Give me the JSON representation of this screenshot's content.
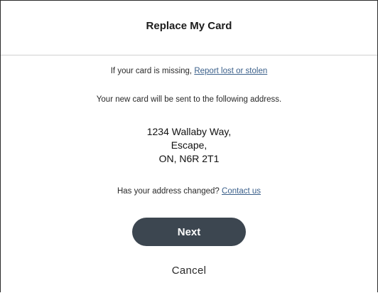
{
  "dialog": {
    "title": "Replace My Card"
  },
  "missing": {
    "prefix": "If your card is missing, ",
    "link": "Report lost or stolen"
  },
  "delivery": {
    "text": "Your new card will be sent to the following address."
  },
  "address": {
    "line1": "1234 Wallaby Way,",
    "line2": "Escape,",
    "line3": "ON, N6R 2T1"
  },
  "address_change": {
    "prefix": "Has your address changed? ",
    "link": "Contact us"
  },
  "actions": {
    "next_label": "Next",
    "cancel_label": "Cancel"
  },
  "colors": {
    "primary_button": "#3c4650",
    "link": "#3a5f8a"
  }
}
